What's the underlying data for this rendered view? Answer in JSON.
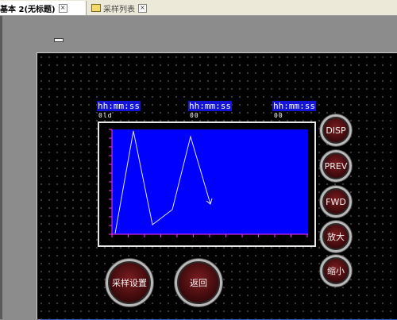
{
  "tabs": [
    {
      "label": "基本 2(无标题)",
      "close": "×"
    },
    {
      "label": "采样列表",
      "close": "×"
    }
  ],
  "labels": {
    "time_1": "hh:mm:ss",
    "time_2": "hh:mm:ss",
    "time_3": "hh:mm:ss",
    "sub_1": "0ld",
    "sub_2": "00",
    "sub_3": "00"
  },
  "buttons": {
    "disp": "DISP",
    "prev": "PREV",
    "fwd": "FWD",
    "zoom_in": "放大",
    "zoom_out": "缩小",
    "sample_settings": "采样设置",
    "back": "返回"
  },
  "trend": {
    "background": "#0000ff",
    "line_color": "#e6e6ff",
    "axis_color": "#ff33ff"
  }
}
